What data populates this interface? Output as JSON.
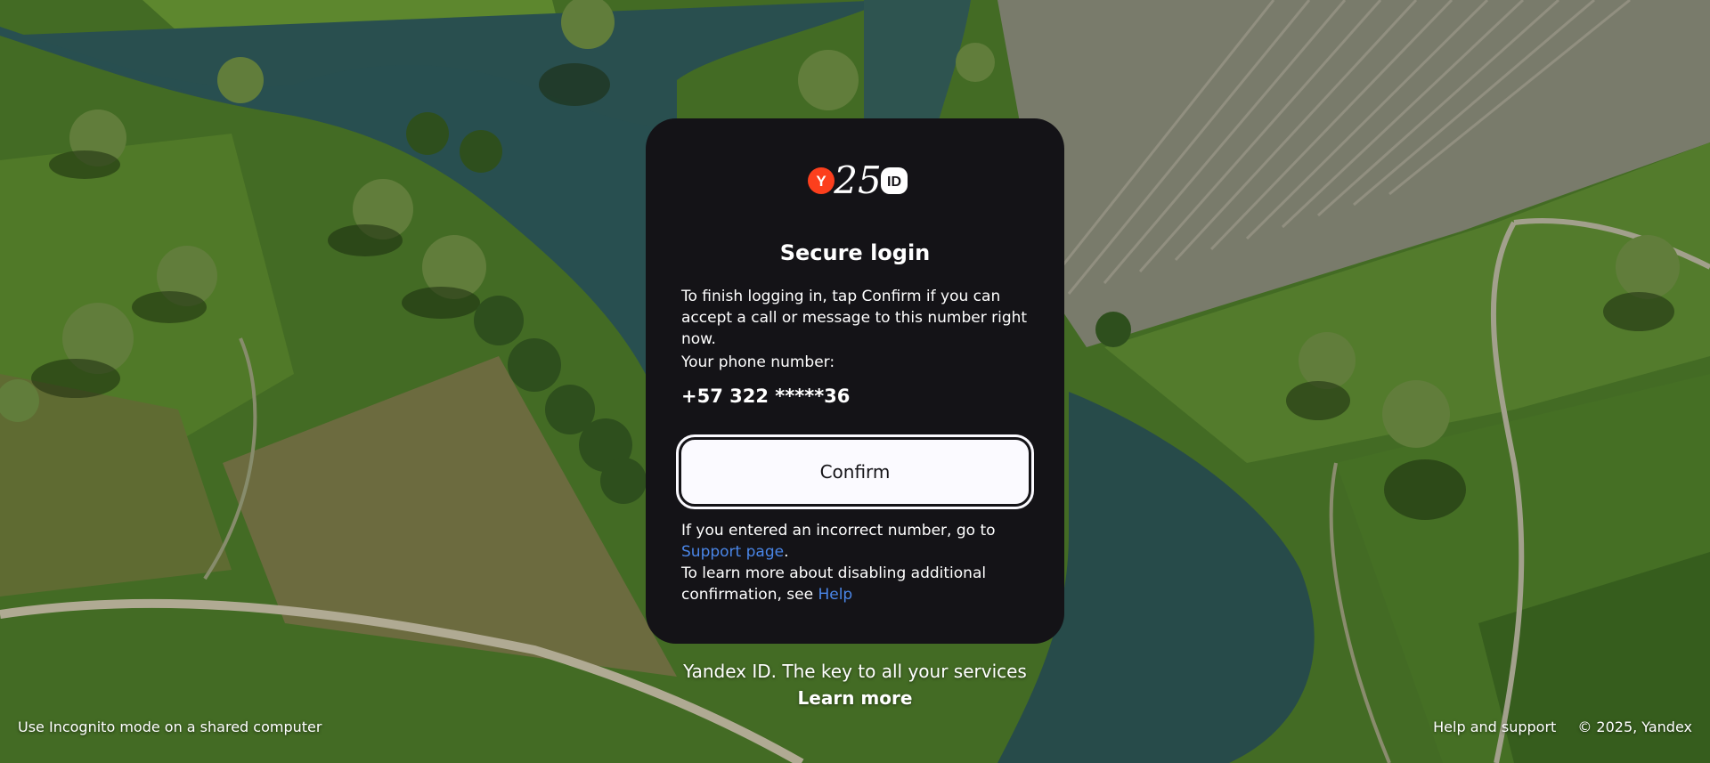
{
  "logo": {
    "badge_letter": "Y",
    "anniversary": "25",
    "id_label": "ID",
    "colors": {
      "badge": "#fc3f1d",
      "text": "#ffffff"
    }
  },
  "card": {
    "title": "Secure login",
    "description": "To finish logging in, tap Confirm if you can accept a call or message to this number right now.",
    "phone_label": "Your phone number:",
    "phone_value": "+57 322 *****36",
    "confirm_label": "Confirm",
    "incorrect_prefix": "If you entered an incorrect number, go to ",
    "support_link": "Support page",
    "incorrect_suffix": ".",
    "disable_prefix": "To learn more about disabling additional confirmation, see ",
    "help_link": "Help"
  },
  "promo": {
    "tagline": "Yandex ID. The key to all your services",
    "learn_more": "Learn more"
  },
  "footer": {
    "incognito_hint": "Use Incognito mode on a shared computer",
    "help_support": "Help and support",
    "copyright": "© 2025, Yandex"
  },
  "colors": {
    "card_bg": "#141317",
    "link": "#4a86e8",
    "button_bg": "#fbfaff"
  }
}
